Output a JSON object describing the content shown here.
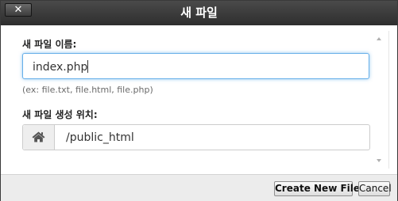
{
  "dialog": {
    "title": "새 파일",
    "close_label": "✕"
  },
  "form": {
    "filename_label": "새 파일 이름:",
    "filename_value": "index.php",
    "filename_hint": "(ex: file.txt, file.html, file.php)",
    "location_label": "새 파일 생성 위치:",
    "location_value": "/public_html",
    "location_icon": "home-icon"
  },
  "footer": {
    "create_label": "Create New File",
    "cancel_label": "Cancel"
  },
  "colors": {
    "titlebar": "#2e2e2e",
    "focus_border": "#66afe9",
    "footer_bg": "#ececec"
  }
}
